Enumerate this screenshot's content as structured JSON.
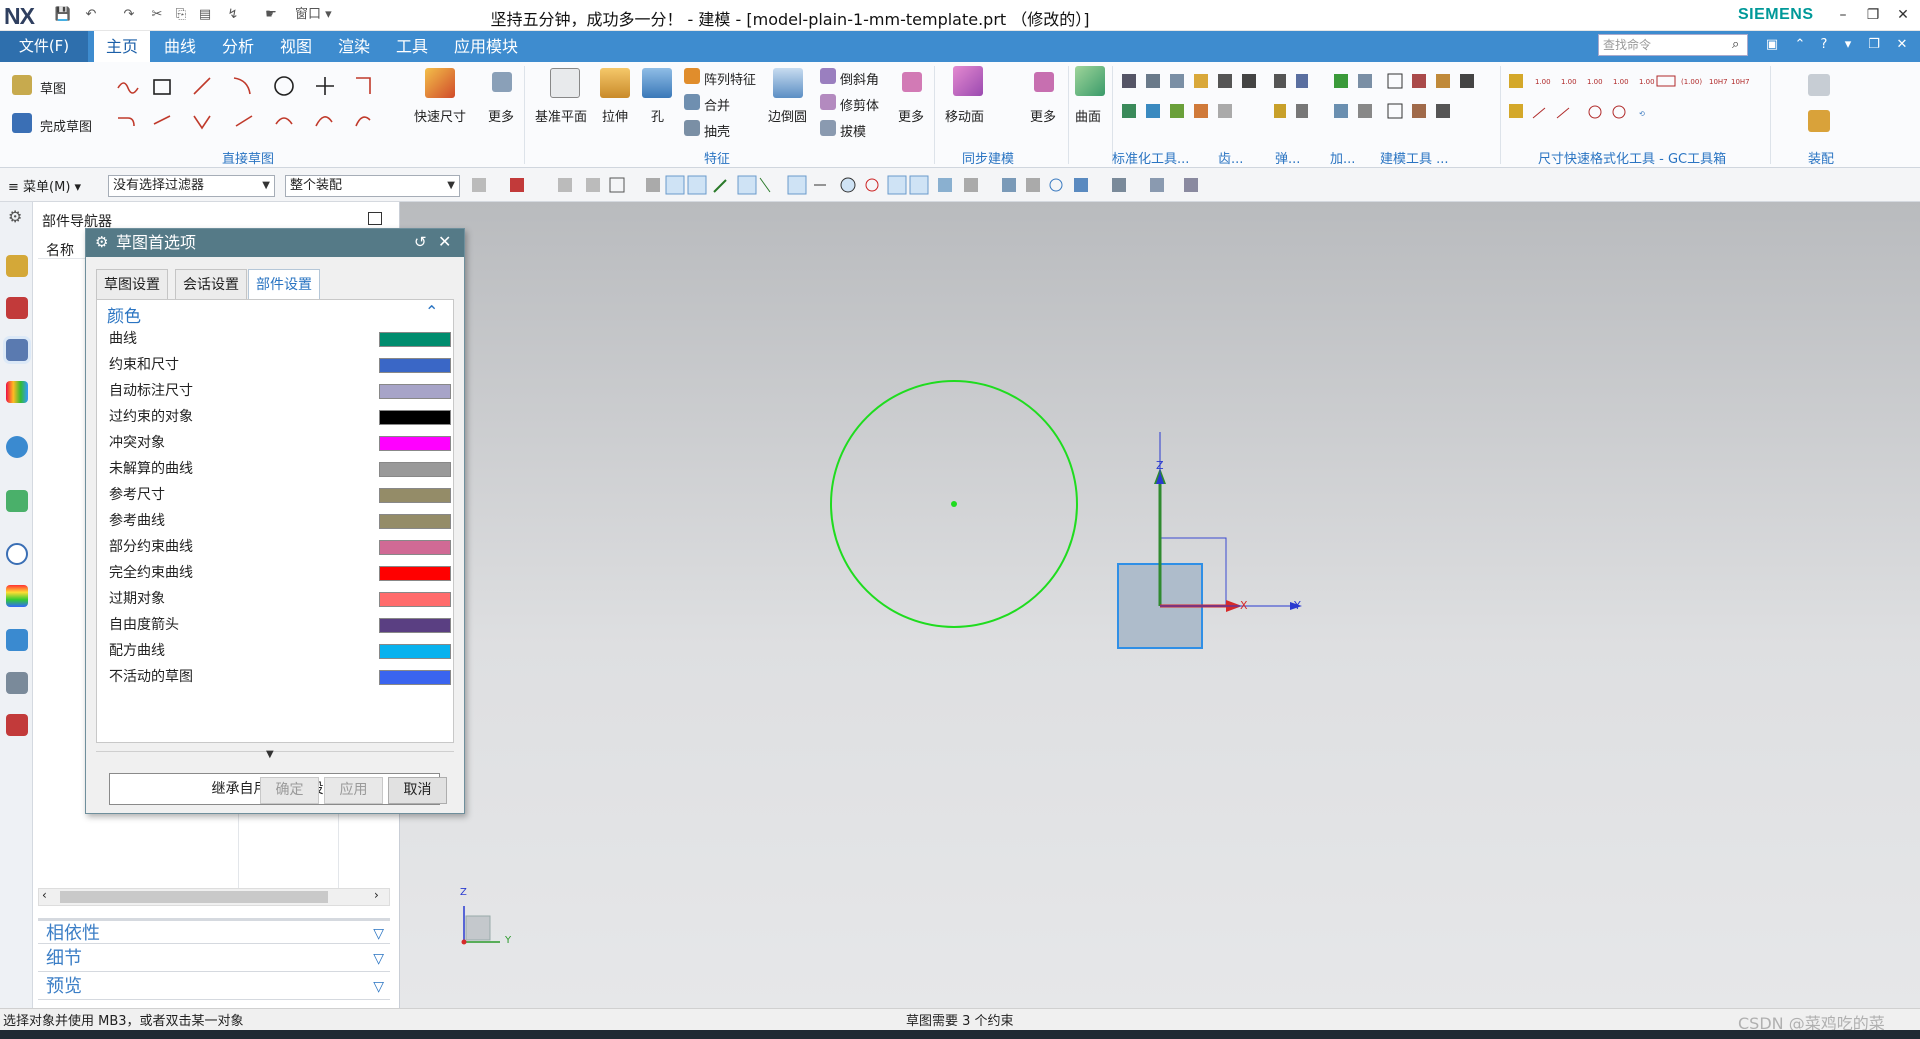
{
  "titlebar": {
    "logo": "NX",
    "title": "坚持五分钟，成功多一分！ - 建模 - [model-plain-1-mm-template.prt （修改的）]",
    "brand": "SIEMENS",
    "window_menu": "窗口"
  },
  "menubar": {
    "file": "文件(F)",
    "tabs": [
      "主页",
      "曲线",
      "分析",
      "视图",
      "渲染",
      "工具",
      "应用模块"
    ],
    "search_placeholder": "查找命令"
  },
  "ribbon": {
    "sketch": "草图",
    "finish_sketch": "完成草图",
    "direct_sketch_group": "直接草图",
    "rapid_dim": "快速尺寸",
    "more": "更多",
    "datum_plane": "基准平面",
    "extrude": "拉伸",
    "hole": "孔",
    "pattern": "阵列特征",
    "unite": "合并",
    "shell": "抽壳",
    "edge_blend": "边倒圆",
    "chamfer": "倒斜角",
    "trim_body": "修剪体",
    "draft": "拔模",
    "feature_group": "特征",
    "move_face": "移动面",
    "sync_group": "同步建模",
    "surface": "曲面",
    "std_tools": "标准化工具...",
    "gear": "齿...",
    "spring": "弹...",
    "add": "加...",
    "modeling_tools": "建模工具 ...",
    "dim_format": "尺寸快速格式化工具 - GC工具箱",
    "assembly": "装配"
  },
  "selbar": {
    "menu": "菜单(M)",
    "filter": "没有选择过滤器",
    "scope": "整个装配"
  },
  "navigator": {
    "title": "部件导航器",
    "col_name": "名称",
    "panels": [
      "相依性",
      "细节",
      "预览"
    ]
  },
  "dialog": {
    "title": "草图首选项",
    "tabs": [
      "草图设置",
      "会话设置",
      "部件设置"
    ],
    "section": "颜色",
    "colors": [
      {
        "label": "曲线",
        "color": "#008c6e"
      },
      {
        "label": "约束和尺寸",
        "color": "#3a67c6"
      },
      {
        "label": "自动标注尺寸",
        "color": "#a7a4c8"
      },
      {
        "label": "过约束的对象",
        "color": "#000000"
      },
      {
        "label": "冲突对象",
        "color": "#ff00ff"
      },
      {
        "label": "未解算的曲线",
        "color": "#999999"
      },
      {
        "label": "参考尺寸",
        "color": "#948c68"
      },
      {
        "label": "参考曲线",
        "color": "#948c68"
      },
      {
        "label": "部分约束曲线",
        "color": "#d06a95"
      },
      {
        "label": "完全约束曲线",
        "color": "#ff0000"
      },
      {
        "label": "过期对象",
        "color": "#ff6b6b"
      },
      {
        "label": "自由度箭头",
        "color": "#5a3f82"
      },
      {
        "label": "配方曲线",
        "color": "#08b2ee"
      },
      {
        "label": "不活动的草图",
        "color": "#3a64ef"
      }
    ],
    "inherit": "继承自用户默认设置",
    "ok": "确定",
    "apply": "应用",
    "cancel": "取消"
  },
  "viewport": {
    "axis_z": "Z",
    "axis_y": "Y",
    "axis_x": "X",
    "circle_color": "#1fdc1f"
  },
  "status": {
    "left": "选择对象并使用 MB3，或者双击某一对象",
    "center": "草图需要 3 个约束",
    "watermark": "CSDN @菜鸡吃的菜"
  }
}
